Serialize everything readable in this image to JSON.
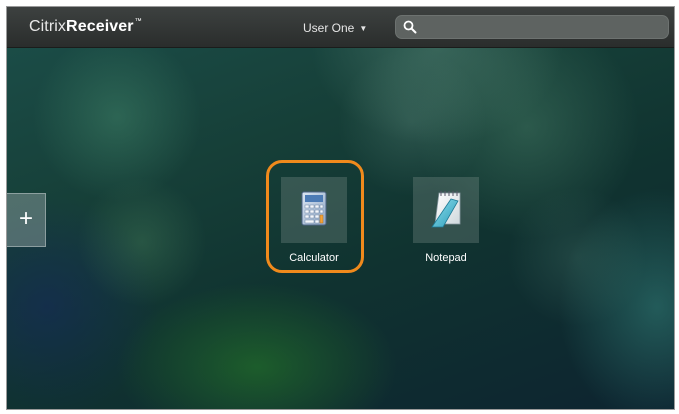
{
  "header": {
    "brand": "Citrix",
    "product": "Receiver",
    "trademark": "™",
    "user_name": "User One",
    "search": {
      "value": "",
      "placeholder": ""
    }
  },
  "sidebar": {
    "add_label": "+"
  },
  "apps": [
    {
      "label": "Calculator",
      "icon": "calculator-icon",
      "highlighted": true
    },
    {
      "label": "Notepad",
      "icon": "notepad-icon",
      "highlighted": false
    }
  ],
  "colors": {
    "highlight": "#f08a1c",
    "topbar": "#333736",
    "background": "#163f38"
  }
}
